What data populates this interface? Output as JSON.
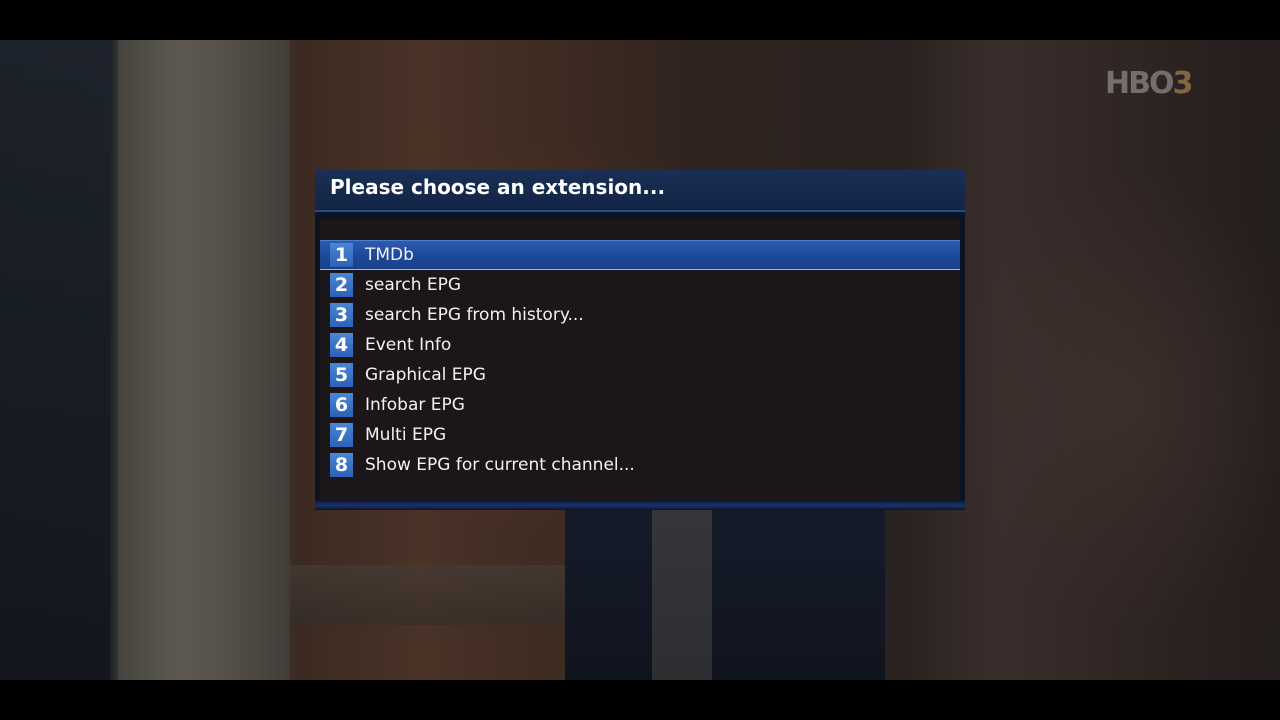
{
  "channel_logo": {
    "text": "HBO",
    "number": "3"
  },
  "dialog": {
    "title": "Please choose an extension...",
    "selected_index": 0,
    "items": [
      {
        "key": "1",
        "label": "TMDb"
      },
      {
        "key": "2",
        "label": "search EPG"
      },
      {
        "key": "3",
        "label": "search EPG from history..."
      },
      {
        "key": "4",
        "label": "Event Info"
      },
      {
        "key": "5",
        "label": "Graphical EPG"
      },
      {
        "key": "6",
        "label": "Infobar EPG"
      },
      {
        "key": "7",
        "label": "Multi EPG"
      },
      {
        "key": "8",
        "label": "Show EPG for current channel..."
      }
    ]
  },
  "colors": {
    "title_bar": "#112445",
    "selection": "#1e4a9a",
    "number_badge": "#3a74c8",
    "text": "#f2f2f2"
  }
}
